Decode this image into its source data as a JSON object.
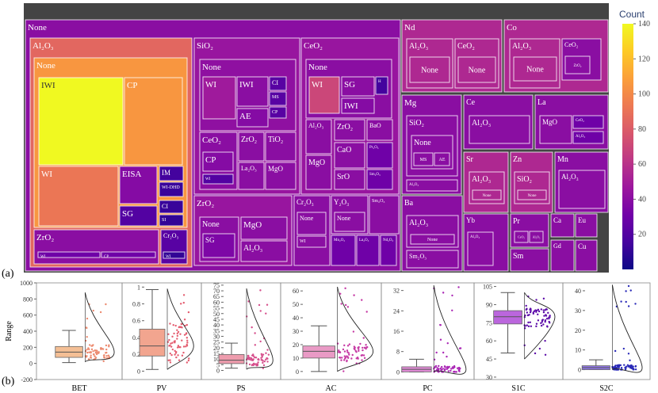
{
  "panel_labels": {
    "a": "(a)",
    "b": "(b)"
  },
  "colors": {
    "frame": "#444444",
    "scale": [
      "#0d0887",
      "#46039f",
      "#7201a8",
      "#9c179e",
      "#bd3786",
      "#d8576b",
      "#ed7953",
      "#fb9f3a",
      "#fdca26",
      "#f0f921"
    ]
  },
  "chart_data": [
    {
      "type": "treemap",
      "colorbar": {
        "title": "Count",
        "ticks": [
          20,
          40,
          60,
          80,
          100,
          120,
          140
        ],
        "range": [
          0,
          140
        ]
      },
      "tiles": [
        {
          "id": "none",
          "label": "None",
          "count": 40,
          "depth": 1
        },
        {
          "id": "al2o3",
          "label": "Al₂O₃",
          "count": 85,
          "depth": 2
        },
        {
          "id": "al2o3-none",
          "label": "None",
          "count": 105,
          "depth": 3
        },
        {
          "id": "iwi",
          "label": "IWI",
          "count": 140,
          "depth": 4
        },
        {
          "id": "cp",
          "label": "CP",
          "count": 105,
          "depth": 4
        },
        {
          "id": "wi",
          "label": "WI",
          "count": 92,
          "depth": 4
        },
        {
          "id": "eisa",
          "label": "EISA",
          "count": 38,
          "depth": 4
        },
        {
          "id": "im",
          "label": "IM",
          "count": 15,
          "depth": 4
        },
        {
          "id": "wi-dhd",
          "label": "WI-DHD",
          "count": 12,
          "depth": 4
        },
        {
          "id": "ci",
          "label": "CI",
          "count": 12,
          "depth": 4
        },
        {
          "id": "sg",
          "label": "SG",
          "count": 20,
          "depth": 4
        },
        {
          "id": "si",
          "label": "SI",
          "count": 10,
          "depth": 4
        },
        {
          "id": "zro2-a",
          "label": "ZrO₂",
          "count": 40,
          "depth": 3
        },
        {
          "id": "zro2-a-bar1",
          "label": "WI",
          "count": 30,
          "depth": 4
        },
        {
          "id": "zro2-a-bar2",
          "label": "CP",
          "count": 30,
          "depth": 4
        },
        {
          "id": "cr2o3-a",
          "label": "Cr₂O₃",
          "count": 22,
          "depth": 3
        },
        {
          "id": "cr2o3-a-wi",
          "label": "WI",
          "count": 10,
          "depth": 4
        },
        {
          "id": "sio2",
          "label": "SiO₂",
          "count": 45,
          "depth": 2
        },
        {
          "id": "sio2-none",
          "label": "None",
          "count": 42,
          "depth": 3
        },
        {
          "id": "sio2-wi",
          "label": "WI",
          "count": 48,
          "depth": 4
        },
        {
          "id": "sio2-iwi",
          "label": "IWI",
          "count": 40,
          "depth": 4
        },
        {
          "id": "sio2-ae",
          "label": "AE",
          "count": 38,
          "depth": 4
        },
        {
          "id": "sio2-ci",
          "label": "CI",
          "count": 22,
          "depth": 4
        },
        {
          "id": "sio2-ms",
          "label": "MS",
          "count": 22,
          "depth": 4
        },
        {
          "id": "sio2-cp",
          "label": "CP",
          "count": 22,
          "depth": 4
        },
        {
          "id": "sio2-ceo2",
          "label": "CeO₂",
          "count": 40,
          "depth": 3
        },
        {
          "id": "sio2-ceo2-cp",
          "label": "CP",
          "count": 38,
          "depth": 4
        },
        {
          "id": "sio2-ceo2-wi",
          "label": "WI",
          "count": 20,
          "depth": 4
        },
        {
          "id": "sio2-zro2",
          "label": "ZrO₂",
          "count": 40,
          "depth": 3
        },
        {
          "id": "sio2-tio2",
          "label": "TiO₂",
          "count": 40,
          "depth": 3
        },
        {
          "id": "sio2-la2o3",
          "label": "La₂O₃",
          "count": 40,
          "depth": 3
        },
        {
          "id": "sio2-mgo",
          "label": "MgO",
          "count": 40,
          "depth": 3
        },
        {
          "id": "ceo2",
          "label": "CeO₂",
          "count": 45,
          "depth": 2
        },
        {
          "id": "ceo2-none",
          "label": "None",
          "count": 40,
          "depth": 3
        },
        {
          "id": "ceo2-wi",
          "label": "WI",
          "count": 70,
          "depth": 4
        },
        {
          "id": "ceo2-sg",
          "label": "SG",
          "count": 40,
          "depth": 4
        },
        {
          "id": "ceo2-iwi",
          "label": "IWI",
          "count": 38,
          "depth": 4
        },
        {
          "id": "ceo2-h",
          "label": "H",
          "count": 15,
          "depth": 4
        },
        {
          "id": "ceo2-al2o3",
          "label": "Al₂O₃",
          "count": 40,
          "depth": 3
        },
        {
          "id": "ceo2-zro2",
          "label": "ZrO₂",
          "count": 40,
          "depth": 3
        },
        {
          "id": "ceo2-bao",
          "label": "BaO",
          "count": 40,
          "depth": 3
        },
        {
          "id": "ceo2-cao",
          "label": "CaO",
          "count": 40,
          "depth": 3
        },
        {
          "id": "ceo2-pr2o3",
          "label": "Pr₂O₃",
          "count": 30,
          "depth": 3
        },
        {
          "id": "ceo2-mgo",
          "label": "MgO",
          "count": 40,
          "depth": 3
        },
        {
          "id": "ceo2-sro",
          "label": "SrO",
          "count": 40,
          "depth": 3
        },
        {
          "id": "ceo2-sm2o3",
          "label": "Sm₂O₃",
          "count": 30,
          "depth": 3
        },
        {
          "id": "zro2",
          "label": "ZrO₂",
          "count": 45,
          "depth": 2
        },
        {
          "id": "zro2-none",
          "label": "None",
          "count": 40,
          "depth": 3
        },
        {
          "id": "zro2-sg",
          "label": "SG",
          "count": 35,
          "depth": 4
        },
        {
          "id": "zro2-mgo",
          "label": "MgO",
          "count": 40,
          "depth": 3
        },
        {
          "id": "zro2-al2o3",
          "label": "Al₂O₃",
          "count": 40,
          "depth": 3
        },
        {
          "id": "cr2o3",
          "label": "Cr₂O₃",
          "count": 40,
          "depth": 2
        },
        {
          "id": "cr2o3-none",
          "label": "None",
          "count": 40,
          "depth": 3
        },
        {
          "id": "cr2o3-wi",
          "label": "WI",
          "count": 40,
          "depth": 4
        },
        {
          "id": "y2o3",
          "label": "Y₂O₃",
          "count": 40,
          "depth": 2
        },
        {
          "id": "y2o3-none",
          "label": "None",
          "count": 40,
          "depth": 3
        },
        {
          "id": "y2o3-mn2o3",
          "label": "Mn₂O₃",
          "count": 30,
          "depth": 3
        },
        {
          "id": "y2o3-la2o3",
          "label": "La₂O₃",
          "count": 30,
          "depth": 3
        },
        {
          "id": "sm2o3",
          "label": "Sm₂O₃",
          "count": 40,
          "depth": 2
        },
        {
          "id": "sm2o3-nd2o3",
          "label": "Nd₂O₃",
          "count": 30,
          "depth": 3
        },
        {
          "id": "nd",
          "label": "Nd",
          "count": 55,
          "depth": 1
        },
        {
          "id": "nd-al2o3",
          "label": "Al₂O₃",
          "count": 55,
          "depth": 2
        },
        {
          "id": "nd-al2o3-none",
          "label": "None",
          "count": 55,
          "depth": 3
        },
        {
          "id": "nd-ceo2",
          "label": "CeO₂",
          "count": 55,
          "depth": 2
        },
        {
          "id": "nd-ceo2-none",
          "label": "None",
          "count": 55,
          "depth": 3
        },
        {
          "id": "co",
          "label": "Co",
          "count": 55,
          "depth": 1
        },
        {
          "id": "co-al2o3",
          "label": "Al₂O₃",
          "count": 55,
          "depth": 2
        },
        {
          "id": "co-al2o3-none",
          "label": "None",
          "count": 55,
          "depth": 3
        },
        {
          "id": "co-ceo2",
          "label": "CeO₂",
          "count": 40,
          "depth": 2
        },
        {
          "id": "co-ceo2-zro2",
          "label": "ZrO₂",
          "count": 40,
          "depth": 3
        },
        {
          "id": "mg",
          "label": "Mg",
          "count": 40,
          "depth": 1
        },
        {
          "id": "mg-sio2",
          "label": "SiO₂",
          "count": 40,
          "depth": 2
        },
        {
          "id": "mg-sio2-none",
          "label": "None",
          "count": 40,
          "depth": 3
        },
        {
          "id": "mg-ms",
          "label": "MS",
          "count": 40,
          "depth": 4
        },
        {
          "id": "mg-ae",
          "label": "AE",
          "count": 40,
          "depth": 4
        },
        {
          "id": "mg-al2o3",
          "label": "Al₂O₃",
          "count": 40,
          "depth": 2
        },
        {
          "id": "ce",
          "label": "Ce",
          "count": 40,
          "depth": 1
        },
        {
          "id": "ce-al2o3",
          "label": "Al₂O₃",
          "count": 40,
          "depth": 2
        },
        {
          "id": "la",
          "label": "La",
          "count": 40,
          "depth": 1
        },
        {
          "id": "la-mgo",
          "label": "MgO",
          "count": 40,
          "depth": 2
        },
        {
          "id": "la-ceo2",
          "label": "CeO₂",
          "count": 30,
          "depth": 2
        },
        {
          "id": "la-al2o3",
          "label": "Al₂O₃",
          "count": 30,
          "depth": 2
        },
        {
          "id": "sr",
          "label": "Sr",
          "count": 55,
          "depth": 1
        },
        {
          "id": "sr-al2o3",
          "label": "Al₂O₃",
          "count": 55,
          "depth": 2
        },
        {
          "id": "sr-none",
          "label": "None",
          "count": 55,
          "depth": 3
        },
        {
          "id": "zn",
          "label": "Zn",
          "count": 55,
          "depth": 1
        },
        {
          "id": "zn-sio2",
          "label": "SiO₂",
          "count": 55,
          "depth": 2
        },
        {
          "id": "zn-none",
          "label": "None",
          "count": 55,
          "depth": 3
        },
        {
          "id": "mn",
          "label": "Mn",
          "count": 40,
          "depth": 1
        },
        {
          "id": "mn-al2o3",
          "label": "Al₂O₃",
          "count": 40,
          "depth": 2
        },
        {
          "id": "ba",
          "label": "Ba",
          "count": 40,
          "depth": 1
        },
        {
          "id": "ba-al2o3",
          "label": "Al₂O₃",
          "count": 40,
          "depth": 2
        },
        {
          "id": "ba-none",
          "label": "None",
          "count": 40,
          "depth": 3
        },
        {
          "id": "ba-sm2o3",
          "label": "Sm₂O₃",
          "count": 40,
          "depth": 2
        },
        {
          "id": "yb",
          "label": "Yb",
          "count": 40,
          "depth": 1
        },
        {
          "id": "yb-al2o3",
          "label": "Al₂O₃",
          "count": 40,
          "depth": 2
        },
        {
          "id": "pr",
          "label": "Pr",
          "count": 40,
          "depth": 1
        },
        {
          "id": "pr-ceo2",
          "label": "CeO₂",
          "count": 40,
          "depth": 2
        },
        {
          "id": "pr-al2o3",
          "label": "Al₂O₃",
          "count": 40,
          "depth": 2
        },
        {
          "id": "ca",
          "label": "Ca",
          "count": 40,
          "depth": 1
        },
        {
          "id": "eu",
          "label": "Eu",
          "count": 40,
          "depth": 1
        },
        {
          "id": "sm",
          "label": "Sm",
          "count": 40,
          "depth": 1
        },
        {
          "id": "gd",
          "label": "Gd",
          "count": 40,
          "depth": 1
        },
        {
          "id": "cu",
          "label": "Cu",
          "count": 40,
          "depth": 1
        }
      ]
    },
    {
      "type": "box",
      "ylabel": "Range",
      "y_ticks_left": [
        -200,
        0,
        200,
        400,
        600,
        800,
        1000
      ],
      "panels": [
        {
          "name": "BET",
          "ylim": [
            -200,
            1000
          ],
          "ticks": [
            -200,
            0,
            200,
            400,
            600,
            800,
            1000
          ],
          "show_ticks": false,
          "whisker_low": 10,
          "q1": 75,
          "median": 140,
          "q3": 210,
          "whisker_high": 410,
          "fill": "#f4bf95",
          "point_color": "#ec8a6f",
          "points_range": [
            20,
            880
          ]
        },
        {
          "name": "PV",
          "ylim": [
            -0.1,
            1.05
          ],
          "ticks": [
            0.0,
            0.2,
            0.4,
            0.6,
            0.8,
            1.0
          ],
          "whisker_low": 0.02,
          "q1": 0.18,
          "median": 0.3,
          "q3": 0.5,
          "whisker_high": 0.97,
          "fill": "#f2a58f",
          "point_color": "#e45d70",
          "points_range": [
            0.02,
            0.98
          ]
        },
        {
          "name": "PS",
          "ylim": [
            -8,
            77
          ],
          "ticks": [
            0,
            5,
            10,
            15,
            20,
            25,
            30,
            35,
            40,
            45,
            50,
            55,
            60,
            65,
            70,
            75
          ],
          "whisker_low": 2,
          "q1": 6,
          "median": 9,
          "q3": 14,
          "whisker_high": 24,
          "fill": "#ee9cad",
          "point_color": "#d64f8c",
          "points_range": [
            1,
            72
          ]
        },
        {
          "name": "AC",
          "ylim": [
            -6,
            66
          ],
          "ticks": [
            0,
            10,
            20,
            30,
            40,
            50,
            60
          ],
          "whisker_low": 0,
          "q1": 10,
          "median": 15,
          "q3": 19,
          "whisker_high": 34,
          "fill": "#e99ac5",
          "point_color": "#c63aa4",
          "points_range": [
            0,
            63
          ]
        },
        {
          "name": "PC",
          "ylim": [
            -3,
            35
          ],
          "ticks": [
            0,
            8,
            16,
            24,
            32
          ],
          "whisker_low": 0,
          "q1": 0,
          "median": 1,
          "q3": 2,
          "whisker_high": 5,
          "fill": "#e08ad6",
          "point_color": "#aa27b5",
          "points_range": [
            0,
            34
          ]
        },
        {
          "name": "S1C",
          "ylim": [
            28,
            108
          ],
          "ticks": [
            30,
            45,
            60,
            75,
            90,
            105
          ],
          "whisker_low": 50,
          "q1": 74,
          "median": 80,
          "q3": 85,
          "whisker_high": 100,
          "fill": "#bb66dd",
          "point_color": "#5b0aa8",
          "points_range": [
            45,
            100
          ]
        },
        {
          "name": "S2C",
          "ylim": [
            -5,
            44
          ],
          "ticks": [
            0,
            10,
            20,
            30,
            40
          ],
          "whisker_low": 0,
          "q1": 0,
          "median": 1,
          "q3": 2,
          "whisker_high": 5,
          "fill": "#8f76e6",
          "point_color": "#2a2ab8",
          "points_range": [
            0,
            43
          ]
        }
      ]
    }
  ]
}
